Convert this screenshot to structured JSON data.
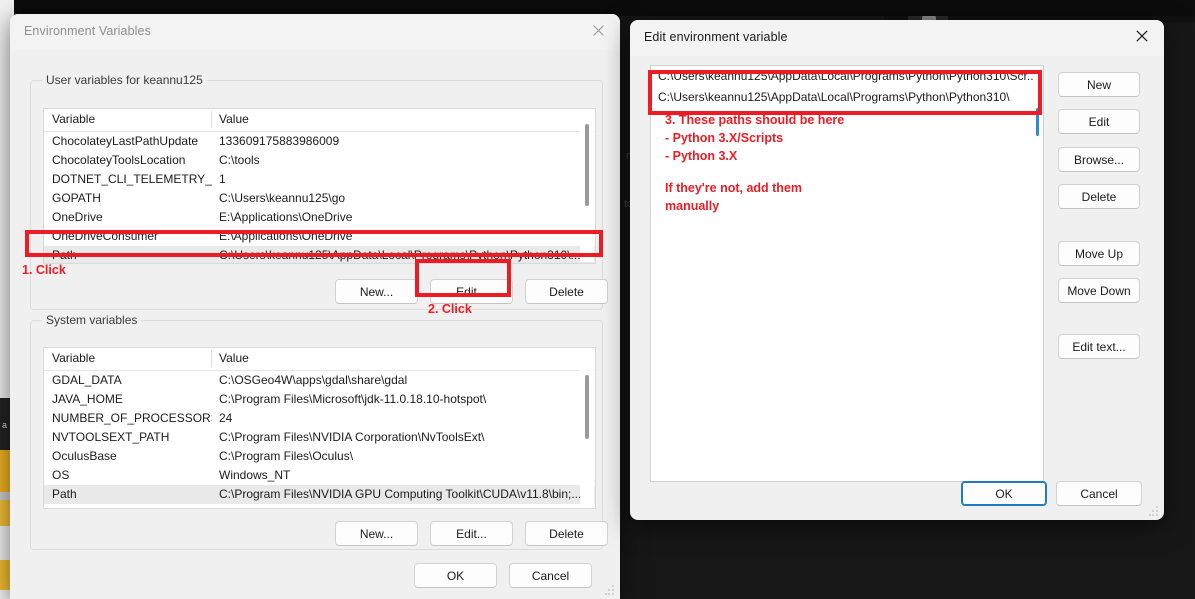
{
  "background": {
    "ghost_texts": [
      "ne",
      "to"
    ],
    "dark_color": "#171717"
  },
  "env_dialog": {
    "title": "Environment Variables",
    "close_icon": "close-icon",
    "user_group": {
      "legend": "User variables for keannu125",
      "columns": [
        "Variable",
        "Value"
      ],
      "rows": [
        {
          "variable": "ChocolateyLastPathUpdate",
          "value": "133609175883986009"
        },
        {
          "variable": "ChocolateyToolsLocation",
          "value": "C:\\tools"
        },
        {
          "variable": "DOTNET_CLI_TELEMETRY_O...",
          "value": "1"
        },
        {
          "variable": "GOPATH",
          "value": "C:\\Users\\keannu125\\go"
        },
        {
          "variable": "OneDrive",
          "value": "E:\\Applications\\OneDrive"
        },
        {
          "variable": "OneDriveConsumer",
          "value": "E:\\Applications\\OneDrive"
        },
        {
          "variable": "Path",
          "value": "C:\\Users\\keannu125\\AppData\\Local\\Programs\\Python\\Python310\\..."
        }
      ],
      "buttons": {
        "new": "New...",
        "edit": "Edit...",
        "delete": "Delete"
      }
    },
    "system_group": {
      "legend": "System variables",
      "columns": [
        "Variable",
        "Value"
      ],
      "rows": [
        {
          "variable": "GDAL_DATA",
          "value": "C:\\OSGeo4W\\apps\\gdal\\share\\gdal"
        },
        {
          "variable": "JAVA_HOME",
          "value": "C:\\Program Files\\Microsoft\\jdk-11.0.18.10-hotspot\\"
        },
        {
          "variable": "NUMBER_OF_PROCESSORS",
          "value": "24"
        },
        {
          "variable": "NVTOOLSEXT_PATH",
          "value": "C:\\Program Files\\NVIDIA Corporation\\NvToolsExt\\"
        },
        {
          "variable": "OculusBase",
          "value": "C:\\Program Files\\Oculus\\"
        },
        {
          "variable": "OS",
          "value": "Windows_NT"
        },
        {
          "variable": "Path",
          "value": "C:\\Program Files\\NVIDIA GPU Computing Toolkit\\CUDA\\v11.8\\bin;..."
        }
      ],
      "buttons": {
        "new": "New...",
        "edit": "Edit...",
        "delete": "Delete"
      }
    },
    "footer": {
      "ok": "OK",
      "cancel": "Cancel"
    }
  },
  "edit_dialog": {
    "title": "Edit environment variable",
    "close_icon": "close-icon",
    "path_rows": [
      "C:\\Users\\keannu125\\AppData\\Local\\Programs\\Python\\Python310\\Scr...",
      "C:\\Users\\keannu125\\AppData\\Local\\Programs\\Python\\Python310\\"
    ],
    "side_buttons": {
      "new": "New",
      "edit": "Edit",
      "browse": "Browse...",
      "delete": "Delete",
      "move_up": "Move Up",
      "move_down": "Move Down",
      "edit_text": "Edit text..."
    },
    "footer": {
      "ok": "OK",
      "cancel": "Cancel"
    }
  },
  "annotations": {
    "accent_color": "#ed1c24",
    "step1": "1. Click",
    "step2": "2. Click",
    "step3_line1": "3. These paths should be here",
    "step3_line2": "- Python 3.X/Scripts",
    "step3_line3": "- Python 3.X",
    "step3_line4": "If they're not, add them",
    "step3_line5": "manually"
  }
}
